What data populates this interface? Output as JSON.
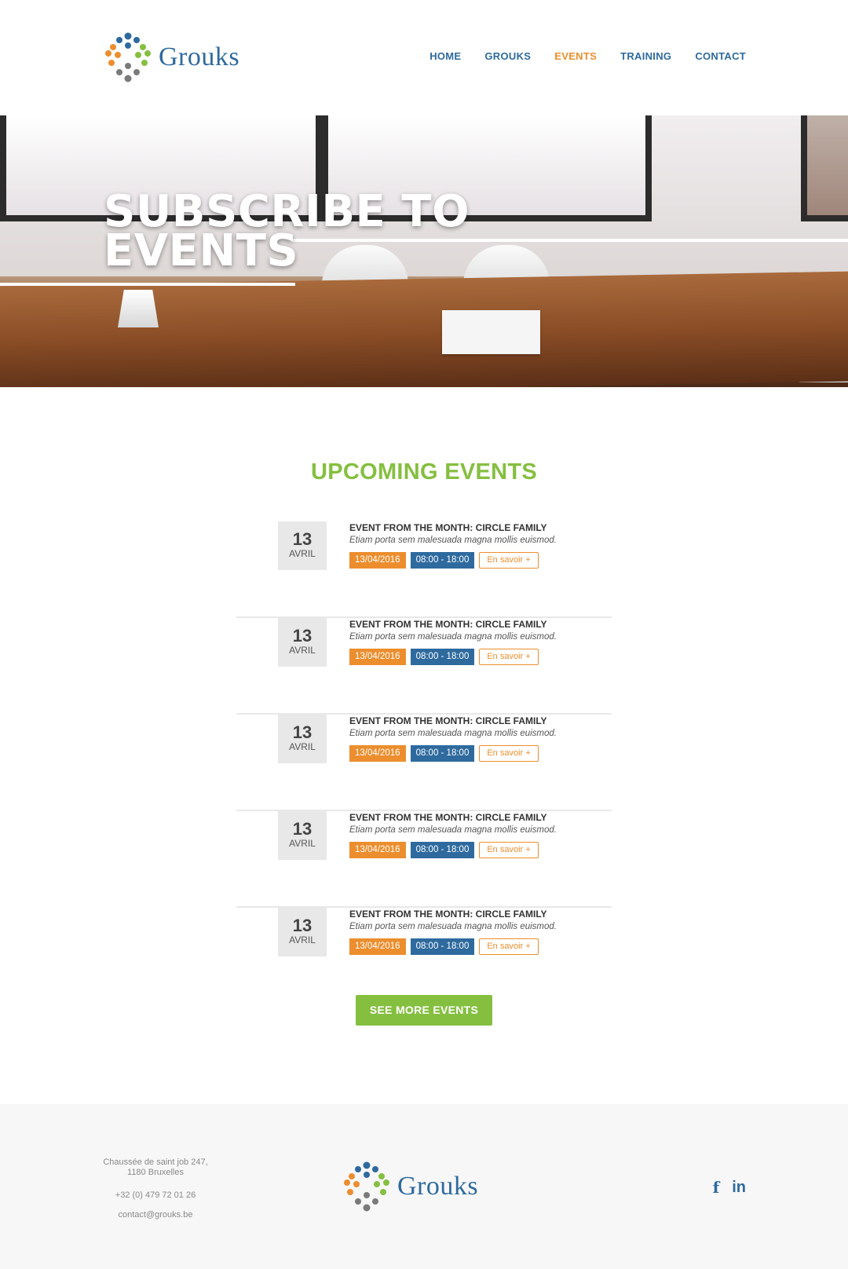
{
  "header": {
    "logo_text": "Grouks",
    "nav": [
      {
        "label": "HOME",
        "active": false
      },
      {
        "label": "GROUKS",
        "active": false
      },
      {
        "label": "EVENTS",
        "active": true
      },
      {
        "label": "TRAINING",
        "active": false
      },
      {
        "label": "CONTACT",
        "active": false
      }
    ]
  },
  "hero": {
    "title_line1": "SUBSCRIBE TO",
    "title_line2": "EVENTS"
  },
  "events_section": {
    "title": "UPCOMING EVENTS",
    "see_more_label": "SEE MORE EVENTS",
    "events": [
      {
        "day": "13",
        "month": "AVRIL",
        "title": "EVENT FROM THE MONTH: CIRCLE FAMILY",
        "description": "Etiam porta sem malesuada magna mollis euismod.",
        "date": "13/04/2016",
        "time": "08:00 - 18:00",
        "more_label": "En savoir +"
      },
      {
        "day": "13",
        "month": "AVRIL",
        "title": "EVENT FROM THE MONTH: CIRCLE FAMILY",
        "description": "Etiam porta sem malesuada magna mollis euismod.",
        "date": "13/04/2016",
        "time": "08:00 - 18:00",
        "more_label": "En savoir +"
      },
      {
        "day": "13",
        "month": "AVRIL",
        "title": "EVENT FROM THE MONTH: CIRCLE FAMILY",
        "description": "Etiam porta sem malesuada magna mollis euismod.",
        "date": "13/04/2016",
        "time": "08:00 - 18:00",
        "more_label": "En savoir +"
      },
      {
        "day": "13",
        "month": "AVRIL",
        "title": "EVENT FROM THE MONTH: CIRCLE FAMILY",
        "description": "Etiam porta sem malesuada magna mollis euismod.",
        "date": "13/04/2016",
        "time": "08:00 - 18:00",
        "more_label": "En savoir +"
      },
      {
        "day": "13",
        "month": "AVRIL",
        "title": "EVENT FROM THE MONTH: CIRCLE FAMILY",
        "description": "Etiam porta sem malesuada magna mollis euismod.",
        "date": "13/04/2016",
        "time": "08:00 - 18:00",
        "more_label": "En savoir +"
      }
    ]
  },
  "footer": {
    "address_line1": "Chaussée de saint job 247,",
    "address_line2": "1180 Bruxelles",
    "phone": "+32 (0) 479 72 01 26",
    "email": "contact@grouks.be",
    "logo_text": "Grouks",
    "social": [
      {
        "icon": "facebook-icon",
        "glyph": "f"
      },
      {
        "icon": "linkedin-icon",
        "glyph": "in"
      }
    ]
  },
  "colors": {
    "brand_blue": "#2e6a9e",
    "brand_orange": "#ec8e2e",
    "brand_green": "#85bf40",
    "brand_gray": "#7a7a7a"
  }
}
